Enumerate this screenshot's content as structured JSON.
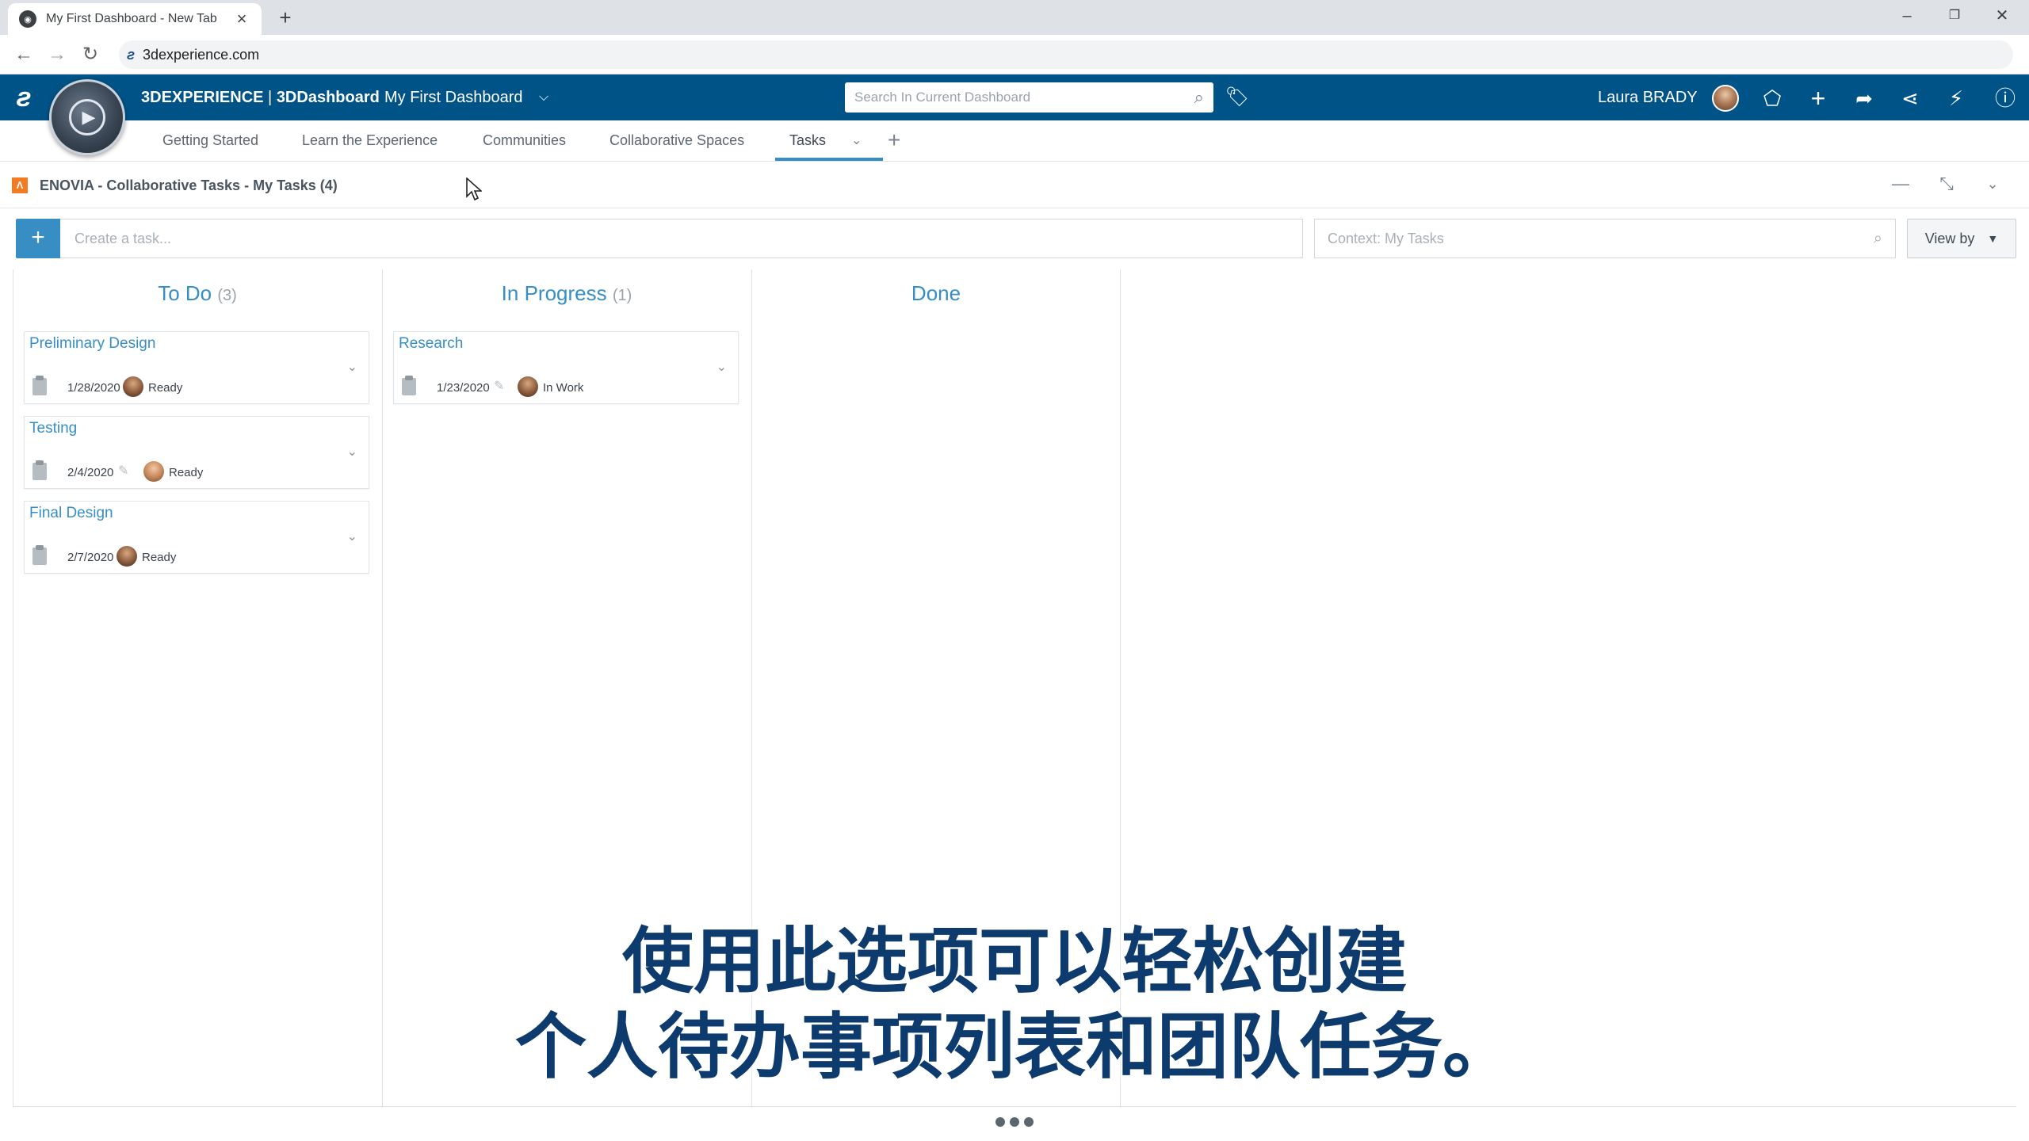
{
  "browser": {
    "tab_title": "My First Dashboard - New Tab",
    "tab_close": "×",
    "new_tab": "+",
    "url": "3dexperience.com",
    "controls": {
      "minimize": "–",
      "restore": "❐",
      "close": "✕"
    }
  },
  "appbar": {
    "brand_bold": "3DEXPERIENCE",
    "brand_sep": " | ",
    "brand_app": "3DDashboard",
    "dashboard_name": "My First Dashboard",
    "search_placeholder": "Search In Current Dashboard",
    "user_name": "Laura BRADY"
  },
  "dashboard_tabs": [
    {
      "label": "Getting Started"
    },
    {
      "label": "Learn the Experience"
    },
    {
      "label": "Communities"
    },
    {
      "label": "Collaborative Spaces"
    },
    {
      "label": "Tasks"
    }
  ],
  "widget": {
    "title": "ENOVIA - Collaborative Tasks - My Tasks (4)",
    "create_placeholder": "Create a task...",
    "context_placeholder": "Context: My Tasks",
    "view_by_label": "View by"
  },
  "columns": [
    {
      "name": "To Do",
      "count": "(3)",
      "cards": [
        {
          "title": "Preliminary Design",
          "date": "1/28/2020",
          "status": "Ready"
        },
        {
          "title": "Testing",
          "date": "2/4/2020",
          "status": "Ready"
        },
        {
          "title": "Final Design",
          "date": "2/7/2020",
          "status": "Ready"
        }
      ]
    },
    {
      "name": "In Progress",
      "count": "(1)",
      "cards": [
        {
          "title": "Research",
          "date": "1/23/2020",
          "status": "In Work"
        }
      ]
    },
    {
      "name": "Done",
      "count": "",
      "cards": []
    }
  ],
  "subtitle": {
    "line1": "使用此选项可以轻松创建",
    "line2": "个人待办事项列表和团队任务。"
  },
  "colors": {
    "app_bar": "#005386",
    "accent": "#368ec4",
    "widget_icon": "#f47b20"
  }
}
